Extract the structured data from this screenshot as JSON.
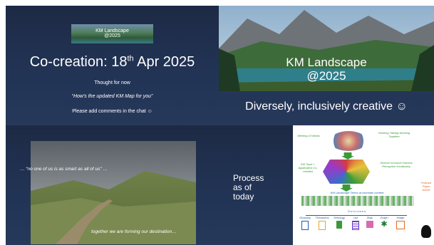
{
  "slide1": {
    "thumb_line1": "KM Landscape",
    "thumb_line2": "@2025",
    "title_main": "Co-creation: 18",
    "title_sup": "th",
    "title_end": " Apr 2025",
    "line1": "Thought for now",
    "line2": "“How's the updated KM Map for you”",
    "line3": "Please add comments in the chat ☺"
  },
  "slide2": {
    "hero_line1": "KM Landscape",
    "hero_line2": "@2025",
    "tagline": "Diversely, inclusively creative ☺"
  },
  "slide3": {
    "quote_top": "… “no one of us is as smart as all of us” …",
    "quote_bottom": "together we are forming our destination…"
  },
  "slide4": {
    "process_line1": "Process",
    "process_line2": "as of",
    "process_line3": "today",
    "diagram": {
      "top_left": "Meeting Of Minds",
      "top_right": "Working Talking Working Together",
      "mid_left": "KM Topic + Application Co-creation",
      "mid_right": "Diverse Inclusive Harvest Recognise Vocabulary",
      "banner": "KM Landscape Terms at concepts content",
      "outcomes_label": "Outcomes",
      "side_label": "Podcast Paper Article",
      "outcomes": [
        "Glossary",
        "Thesaurus",
        "Ontology",
        "List",
        "Map",
        "Graph",
        "Image"
      ]
    }
  },
  "colors": {
    "navy": "#1d2a45",
    "diagram_blue": "#1c5fa8",
    "diagram_green": "#3a9a3a"
  }
}
